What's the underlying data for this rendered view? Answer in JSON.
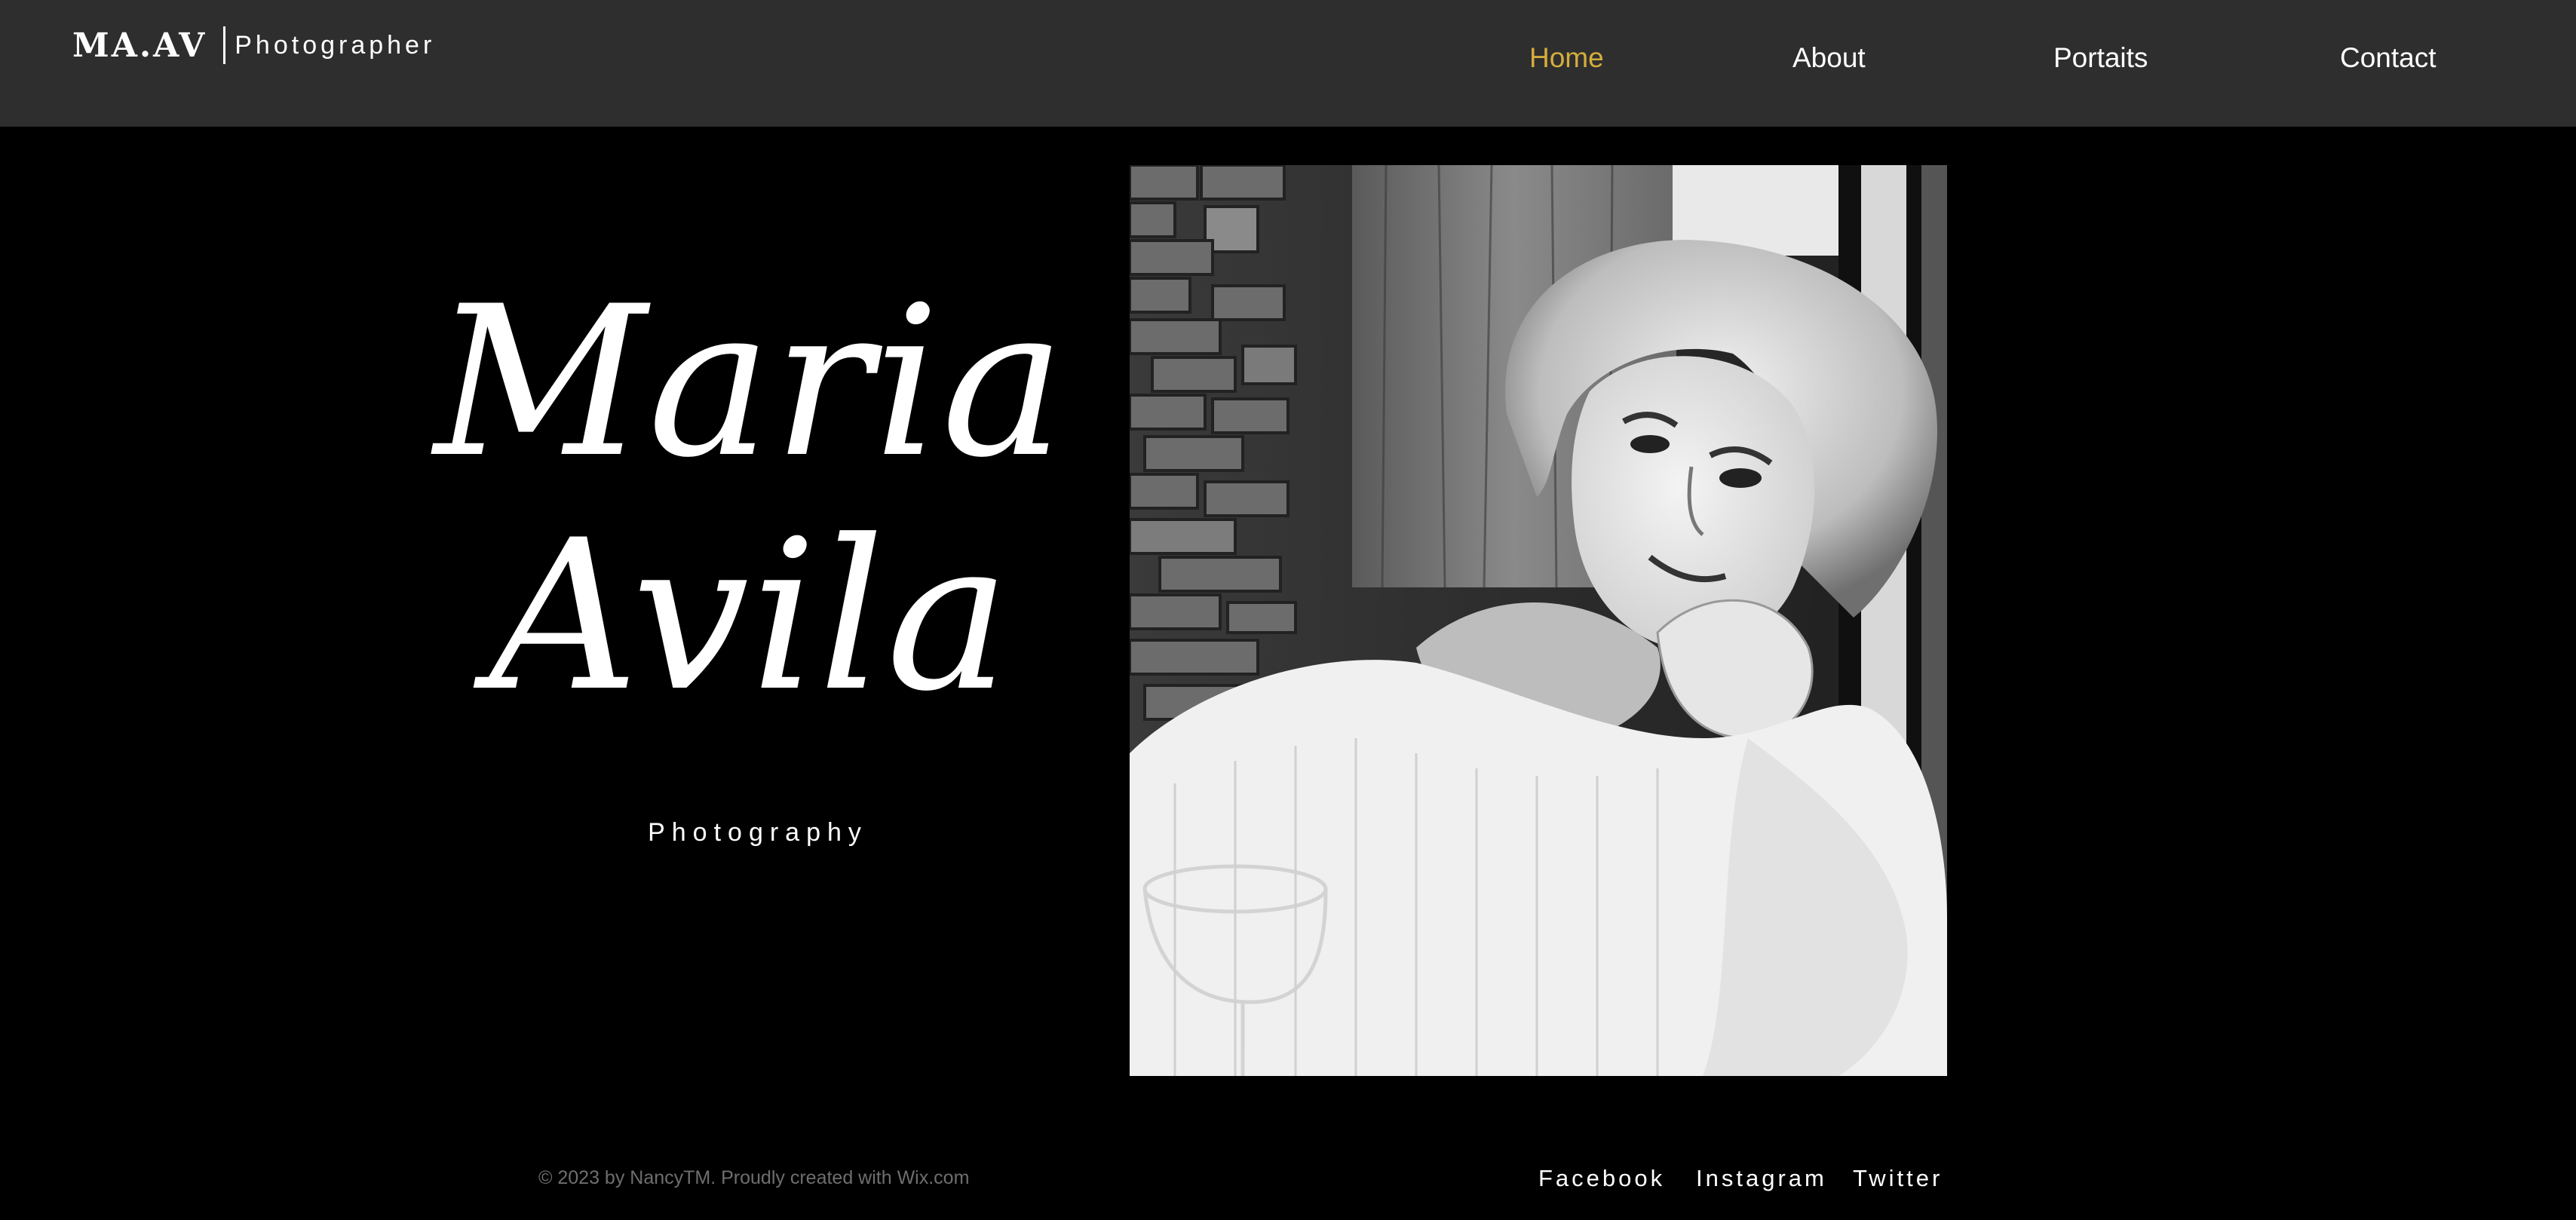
{
  "header": {
    "logo_mark": "MA.AV",
    "logo_sub": "Photographer",
    "background": "#2f2e2f"
  },
  "nav": {
    "items": [
      {
        "label": "Home",
        "active": true
      },
      {
        "label": "About",
        "active": false
      },
      {
        "label": "Portaits",
        "active": false
      },
      {
        "label": "Contact",
        "active": false
      }
    ],
    "active_color": "#d4ad3c"
  },
  "hero": {
    "first_name": "Maria",
    "last_name": "Avila",
    "subtitle": "Photography"
  },
  "photo": {
    "icon": "portrait-photo"
  },
  "footer": {
    "copyright": "© 2023 by NancyTM. Proudly created with Wix.com",
    "social": [
      {
        "label": "Facebook"
      },
      {
        "label": "Instagram"
      },
      {
        "label": "Twitter"
      }
    ]
  }
}
